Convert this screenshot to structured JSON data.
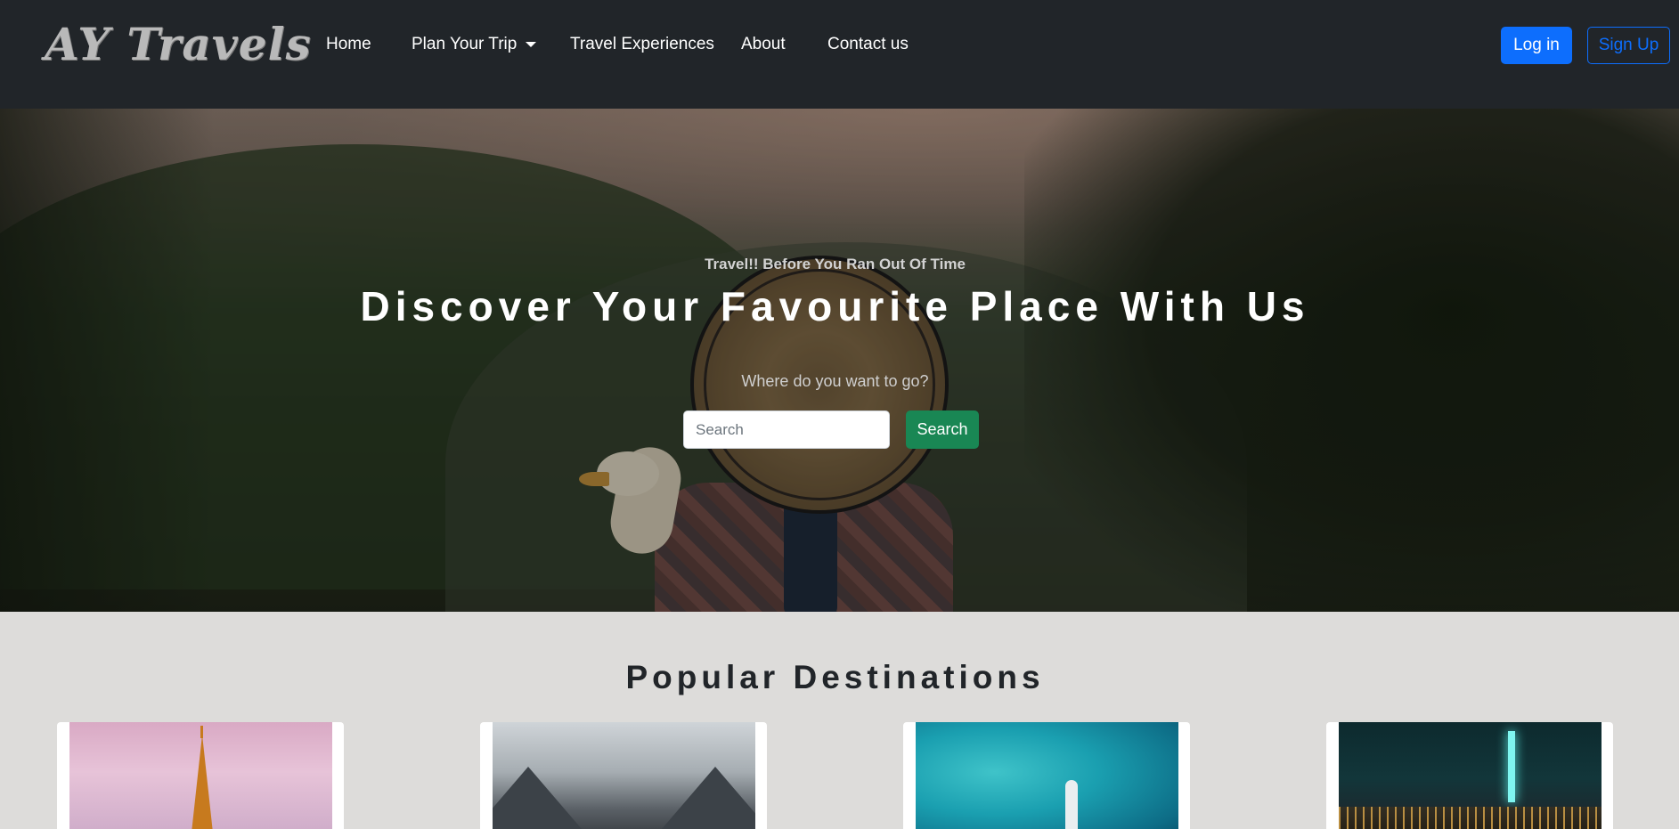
{
  "brand": {
    "name": "AY Travels"
  },
  "nav": {
    "items": [
      {
        "label": "Home"
      },
      {
        "label": "Plan Your Trip"
      },
      {
        "label": "Travel Experiences"
      },
      {
        "label": "About"
      },
      {
        "label": "Contact us"
      }
    ],
    "login_label": "Log in",
    "signup_label": "Sign Up"
  },
  "hero": {
    "tagline": "Travel!! Before You Ran Out Of Time",
    "title": "Discover Your Favourite Place With Us",
    "question": "Where do you want to go?",
    "search_placeholder": "Search",
    "search_button": "Search"
  },
  "destinations": {
    "title": "Popular Destinations",
    "cards": [
      {
        "image": "eiffel-tower-photo"
      },
      {
        "image": "mountain-lake-photo"
      },
      {
        "image": "tropical-sea-kayak-photo"
      },
      {
        "image": "city-night-skyline-photo"
      }
    ]
  },
  "colors": {
    "navbar_bg": "#212529",
    "primary": "#0d6efd",
    "success": "#198754",
    "section_bg": "#dddcda"
  }
}
